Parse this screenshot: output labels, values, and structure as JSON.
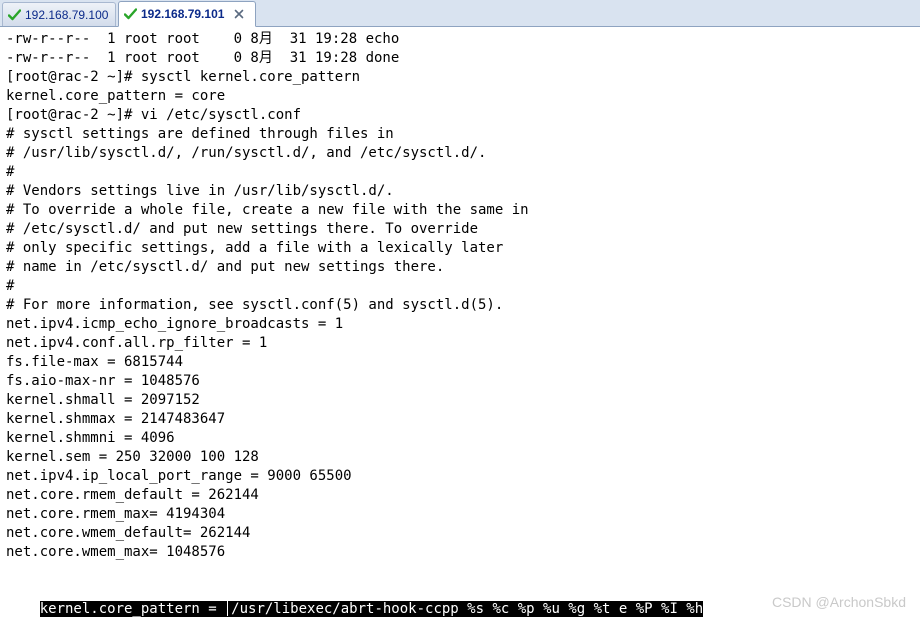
{
  "tabs": [
    {
      "label": "192.168.79.100",
      "active": false
    },
    {
      "label": "192.168.79.101",
      "active": true
    }
  ],
  "terminal": {
    "lines": [
      "-rw-r--r--  1 root root    0 8月  31 19:28 echo",
      "-rw-r--r--  1 root root    0 8月  31 19:28 done",
      "[root@rac-2 ~]# sysctl kernel.core_pattern",
      "kernel.core_pattern = core",
      "[root@rac-2 ~]# vi /etc/sysctl.conf",
      "# sysctl settings are defined through files in",
      "# /usr/lib/sysctl.d/, /run/sysctl.d/, and /etc/sysctl.d/.",
      "#",
      "# Vendors settings live in /usr/lib/sysctl.d/.",
      "# To override a whole file, create a new file with the same in",
      "# /etc/sysctl.d/ and put new settings there. To override",
      "# only specific settings, add a file with a lexically later",
      "# name in /etc/sysctl.d/ and put new settings there.",
      "#",
      "# For more information, see sysctl.conf(5) and sysctl.d(5).",
      "net.ipv4.icmp_echo_ignore_broadcasts = 1",
      "net.ipv4.conf.all.rp_filter = 1",
      "fs.file-max = 6815744",
      "fs.aio-max-nr = 1048576",
      "kernel.shmall = 2097152",
      "kernel.shmmax = 2147483647",
      "kernel.shmmni = 4096",
      "kernel.sem = 250 32000 100 128",
      "net.ipv4.ip_local_port_range = 9000 65500",
      "net.core.rmem_default = 262144",
      "net.core.rmem_max= 4194304",
      "net.core.wmem_default= 262144",
      "net.core.wmem_max= 1048576"
    ],
    "status_line_before_cursor": "kernel.core_pattern = ",
    "status_line_after_cursor": "/usr/libexec/abrt-hook-ccpp %s %c %p %u %g %t e %P %I %h"
  },
  "watermark": "CSDN @ArchonSbkd",
  "colors": {
    "check_green": "#2aa52a",
    "tab_text": "#0b2a8a",
    "highlight_bg": "#000000",
    "highlight_fg": "#ffffff"
  },
  "icons": {
    "tab_status": "check-icon",
    "tab_close": "close-icon"
  }
}
